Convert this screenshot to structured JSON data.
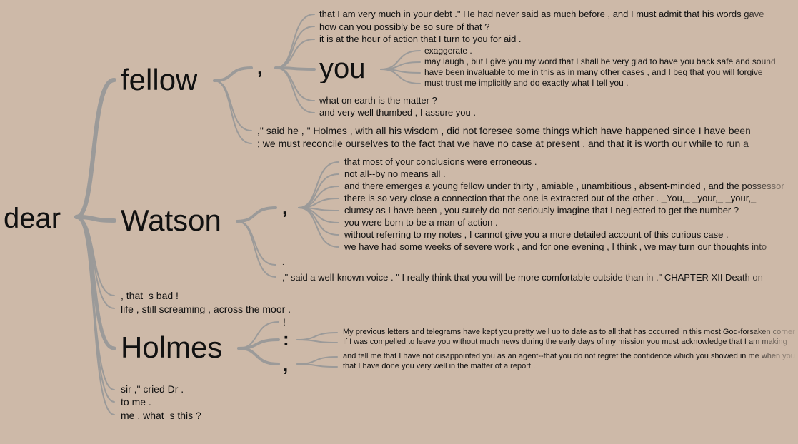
{
  "root": "dear",
  "branches": {
    "fellow": {
      "word": "fellow",
      "comma": ",",
      "lines_top": [
        "that I am very much in your debt .\" He had never said as much before , and I must admit that his words gave",
        "how can you possibly be so sure of that ?",
        "it is at the hour of action that I turn to you for aid ."
      ],
      "you": {
        "word": "you",
        "lines": [
          "exaggerate .",
          "may laugh , but I give you my word that I shall be very glad to have you back safe and sound",
          "have been invaluable to me in this as in many other cases , and I beg that you will forgive",
          "must trust me implicitly and do exactly what I tell you ."
        ]
      },
      "lines_bottom": [
        "what on earth is the matter ?",
        "and very well thumbed , I assure you ."
      ],
      "lines_direct": [
        ",\" said he , \" Holmes , with all his wisdom , did not foresee some things which have happened since I have been",
        "; we must reconcile ourselves to the fact that we have no case at present , and that it is worth our while to run a"
      ]
    },
    "watson": {
      "word": "Watson",
      "comma": ",",
      "lines": [
        "that most of your conclusions were erroneous .",
        "not all--by no means all .",
        "and there emerges a young fellow under thirty , amiable , unambitious , absent-minded , and the possessor",
        "there is so very close a connection that the one is extracted out of the other . _You,_ _your,_ _your,_",
        "clumsy as I have been , you surely do not seriously imagine that I neglected to get the number ?",
        "you were born to be a man of action .",
        "without referring to my notes , I cannot give you a more detailed account of this curious case .",
        "we have had some weeks of severe work , and for one evening , I think , we may turn our thoughts into"
      ],
      "period": ".",
      "direct": ",\" said a well-known voice . \" I really think that you will be more comfortable outside than in .\" CHAPTER XII Death on"
    },
    "mid_lines": [
      ", that_s bad !",
      "life , still screaming , across the moor ."
    ],
    "holmes": {
      "word": "Holmes",
      "exclaim": "!",
      "colon": ":",
      "comma": ",",
      "colon_lines": [
        "My previous letters and telegrams have kept you pretty well up to date as to all that has occurred in this most God-forsaken corner",
        "If I was compelled to leave you without much news during the early days of my mission you must acknowledge that I am making"
      ],
      "comma_lines": [
        "and tell me that I have not disappointed you as an agent--that you do not regret the confidence which you showed in me when you",
        "that I have done you very well in the matter of a report ."
      ]
    },
    "bottom_lines": [
      "sir ,\" cried Dr .",
      "to me .",
      "me , what_s this ?"
    ]
  },
  "colors": {
    "background": "#cdb9a8",
    "branch": "#9b9a99",
    "text": "#111111"
  }
}
